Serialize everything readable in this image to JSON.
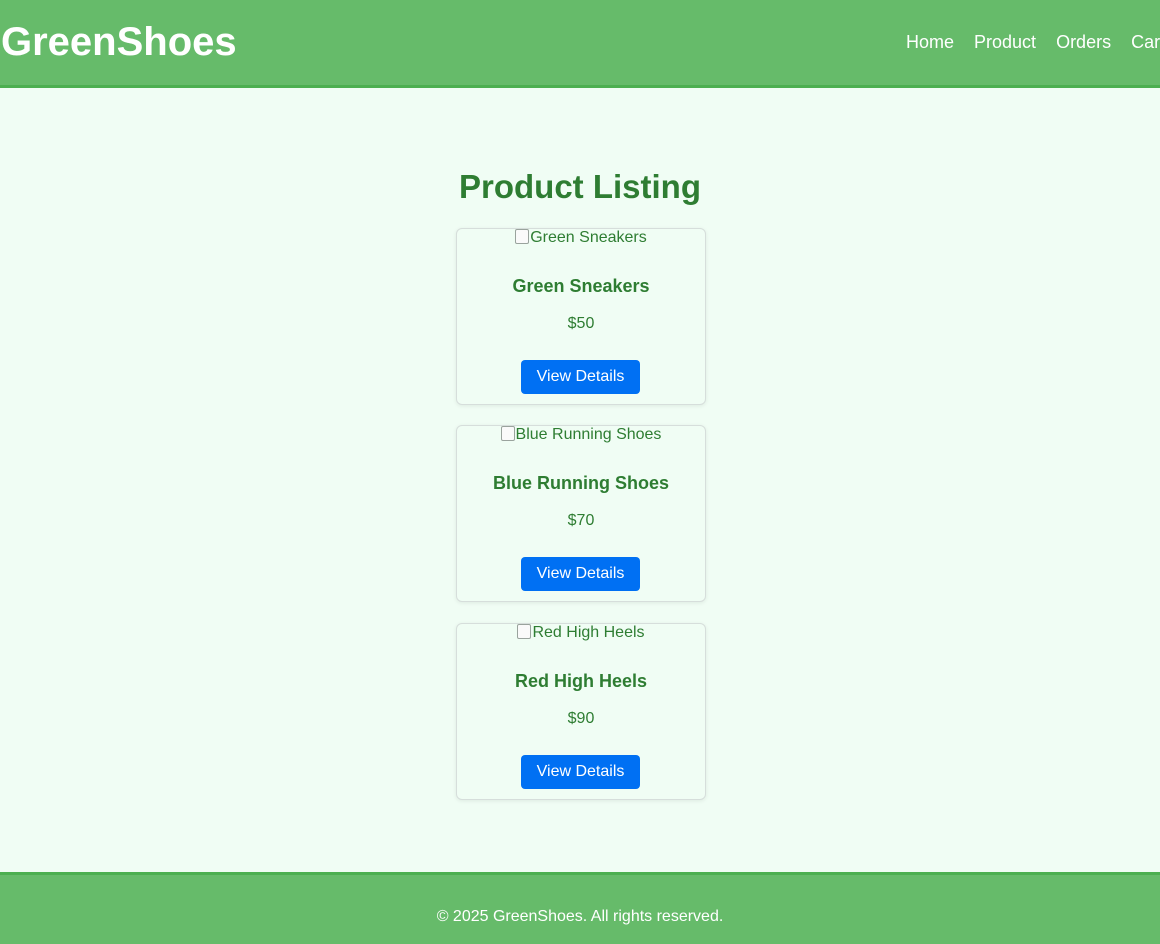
{
  "header": {
    "logo": "GreenShoes",
    "nav": [
      "Home",
      "Product",
      "Orders",
      "Cart"
    ]
  },
  "main": {
    "title": "Product Listing",
    "products": [
      {
        "image_alt": "Green Sneakers",
        "name": "Green Sneakers",
        "price": "$50",
        "button": "View Details"
      },
      {
        "image_alt": "Blue Running Shoes",
        "name": "Blue Running Shoes",
        "price": "$70",
        "button": "View Details"
      },
      {
        "image_alt": "Red High Heels",
        "name": "Red High Heels",
        "price": "$90",
        "button": "View Details"
      }
    ]
  },
  "footer": {
    "text": "© 2025 GreenShoes. All rights reserved."
  },
  "colors": {
    "header_bg": "#66bb6a",
    "page_bg": "#f0fdf4",
    "text_green": "#2e7d32",
    "button_blue": "#0070f3"
  }
}
